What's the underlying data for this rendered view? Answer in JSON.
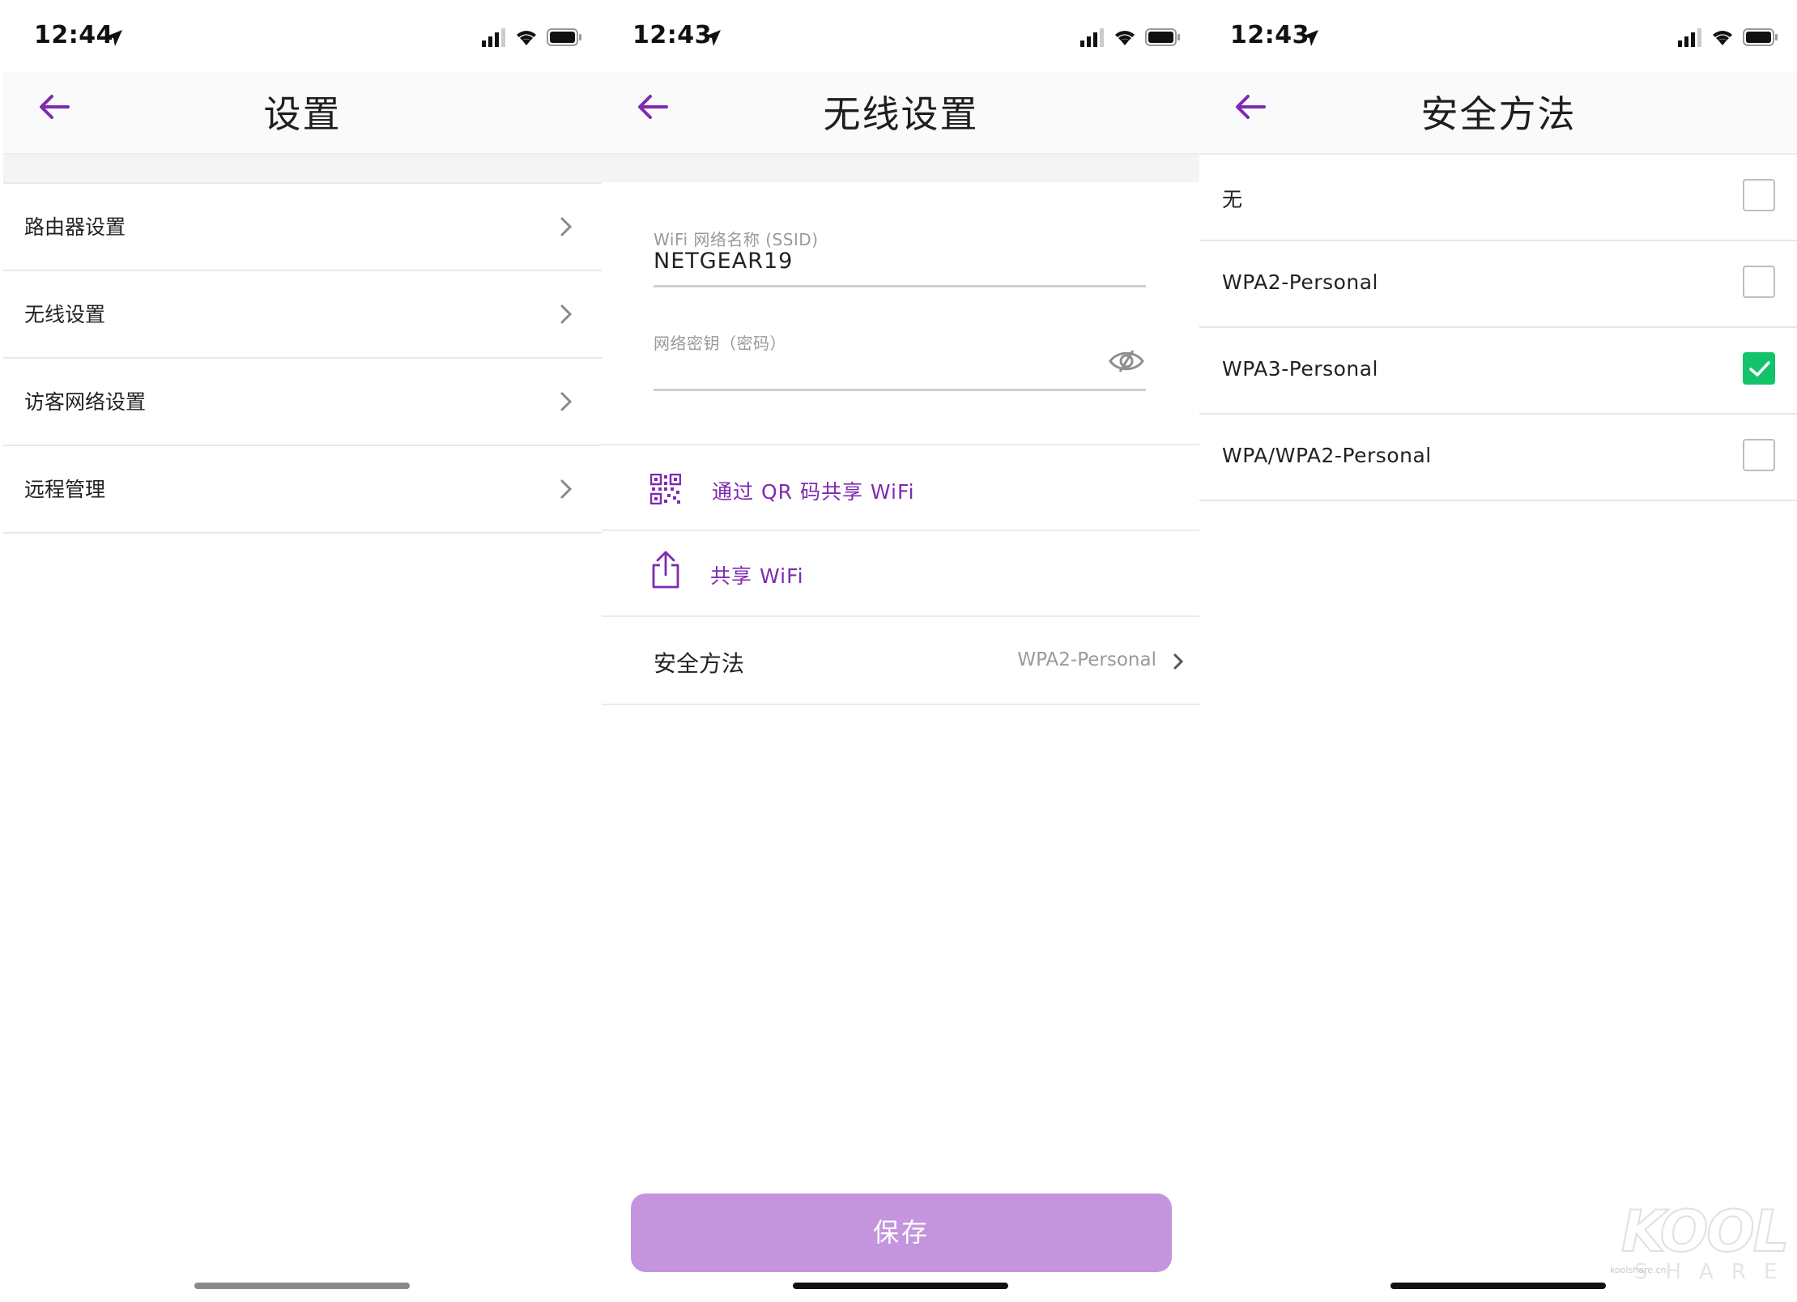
{
  "colors": {
    "accent": "#7e2bb0",
    "save_button": "#c495dc",
    "check_green": "#12c36a",
    "separator": "#e8e8e8"
  },
  "screen1": {
    "time": "12:44",
    "title": "设置",
    "items": [
      {
        "label": "路由器设置"
      },
      {
        "label": "无线设置"
      },
      {
        "label": "访客网络设置"
      },
      {
        "label": "远程管理"
      }
    ]
  },
  "screen2": {
    "time": "12:43",
    "title": "无线设置",
    "ssid_label": "WiFi 网络名称 (SSID)",
    "ssid_value": "NETGEAR19",
    "password_label": "网络密钥（密码）",
    "password_value": "",
    "qr_share_label": "通过 QR 码共享 WiFi",
    "share_label": "共享 WiFi",
    "security_label": "安全方法",
    "security_value": "WPA2-Personal",
    "save_label": "保存"
  },
  "screen3": {
    "time": "12:43",
    "title": "安全方法",
    "options": [
      {
        "label": "无",
        "checked": false
      },
      {
        "label": "WPA2-Personal",
        "checked": false
      },
      {
        "label": "WPA3-Personal",
        "checked": true
      },
      {
        "label": "WPA/WPA2-Personal",
        "checked": false
      }
    ]
  },
  "watermark": {
    "brand": "KOOL",
    "sub": "SHARE",
    "small": "koolshare.cn"
  },
  "icons": {
    "back": "arrow-left-icon",
    "chevron": "chevron-right-icon",
    "eye": "eye-slash-icon",
    "qr": "qr-code-icon",
    "share": "share-icon",
    "check": "checkmark-icon"
  }
}
